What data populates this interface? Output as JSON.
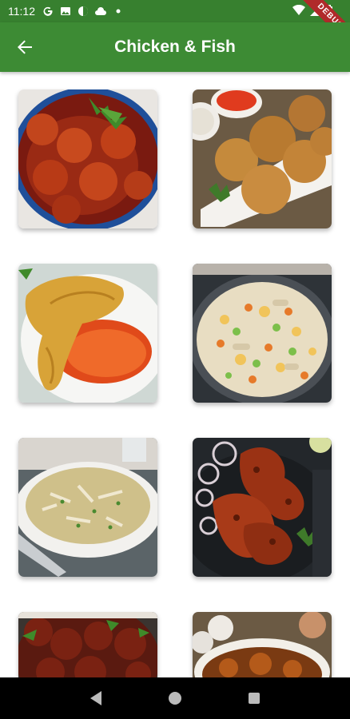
{
  "status": {
    "time": "11:12"
  },
  "debug_banner": "DEBUG",
  "app_bar": {
    "title": "Chicken & Fish"
  },
  "colors": {
    "app_bar": "#3d8b34",
    "status_bar": "#37802f",
    "nav_bar": "#000000"
  },
  "recipes": [
    {
      "icon": "shrimp-curry-image"
    },
    {
      "icon": "fish-balls-image"
    },
    {
      "icon": "chicken-roast-image"
    },
    {
      "icon": "chicken-fried-rice-image"
    },
    {
      "icon": "chicken-soup-image"
    },
    {
      "icon": "tandoori-chicken-image"
    },
    {
      "icon": "chilli-chicken-image"
    },
    {
      "icon": "chicken-curry-image"
    }
  ],
  "nav": {
    "back": "back-triangle-icon",
    "home": "home-circle-icon",
    "recents": "recents-square-icon"
  }
}
